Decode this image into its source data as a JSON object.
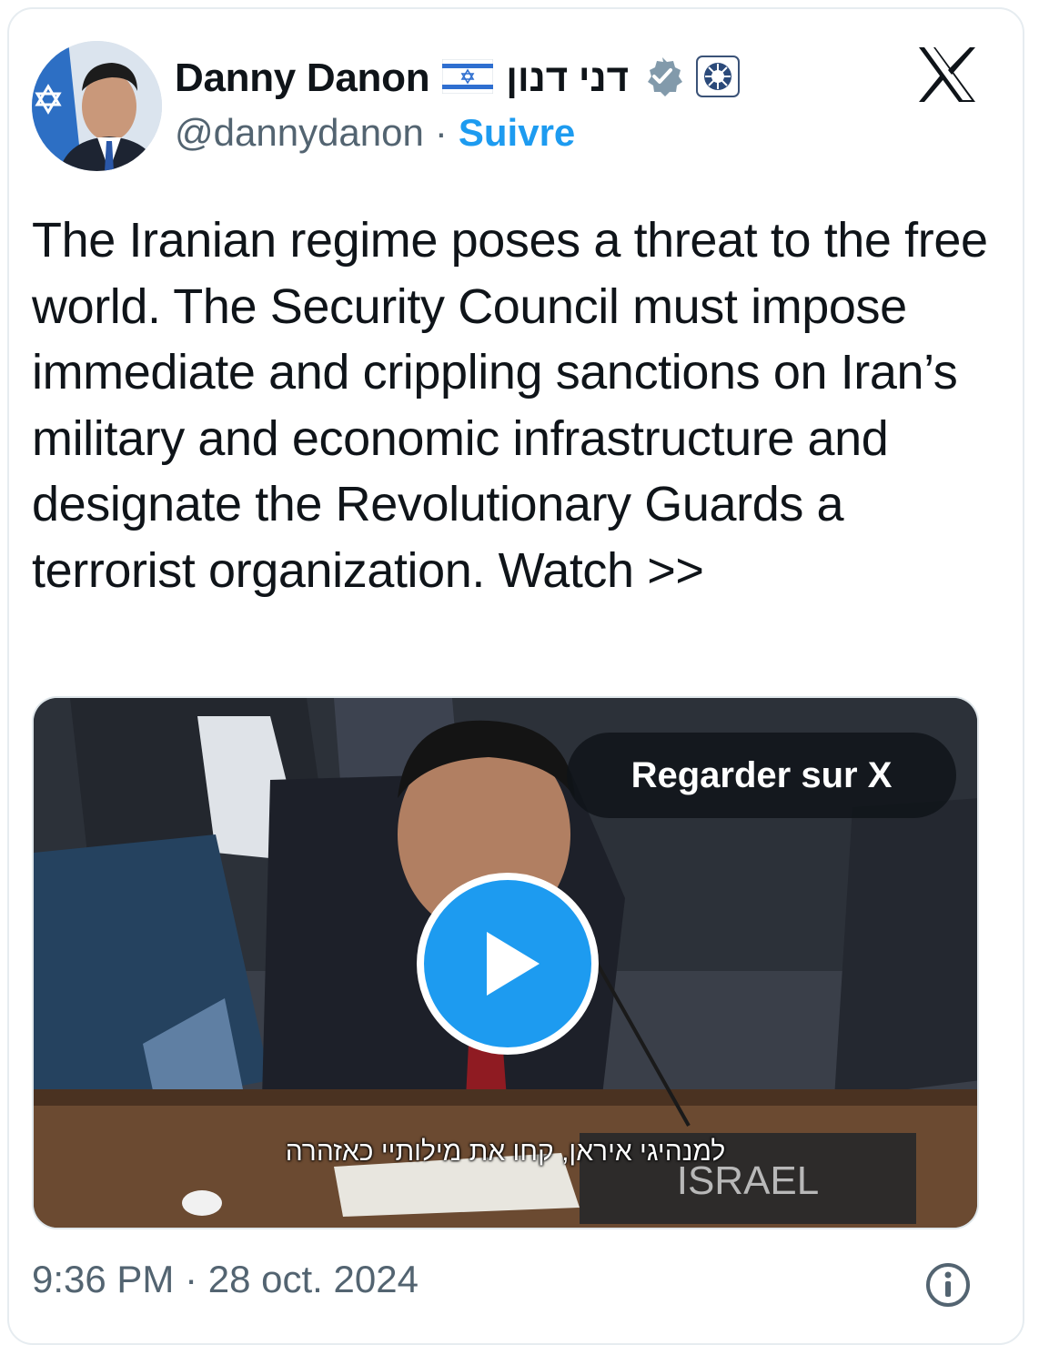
{
  "author": {
    "display_name": "Danny Danon",
    "hebrew_name": "דני דנון",
    "handle": "@dannydanon",
    "separator": "·",
    "follow_label": "Suivre"
  },
  "icons": {
    "flag": "israel-flag-icon",
    "verified": "verified-badge-icon",
    "affiliation": "affiliation-badge-icon",
    "platform": "x-logo-icon",
    "info": "info-icon"
  },
  "tweet": {
    "text": "The Iranian regime poses a threat to the free world. The Security Council must impose immediate and crippling sanctions on Iran’s military and economic infrastructure and designate the Revolutionary Guards a terrorist organization. Watch >>"
  },
  "media": {
    "watch_label": "Regarder sur X",
    "subtitle": "למנהיגי איראן, קחו את מילותיי כאזהרה",
    "nameplate": "ISRAEL"
  },
  "footer": {
    "timestamp": "9:36 PM · 28 oct. 2024"
  },
  "colors": {
    "accent": "#1d9bf0",
    "text": "#0f1419",
    "secondary": "#536471",
    "verified_gray": "#829aab"
  }
}
